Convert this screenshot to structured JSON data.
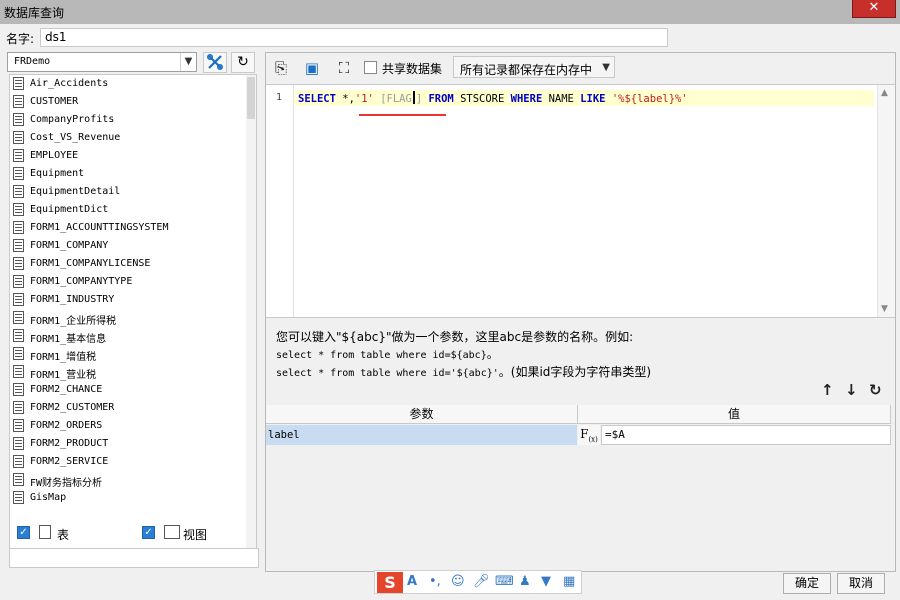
{
  "window": {
    "title": "数据库查询",
    "close_glyph": "✕"
  },
  "name_field": {
    "label": "名字:",
    "value": "ds1"
  },
  "left": {
    "connection": "FRDemo",
    "tables": [
      "Air_Accidents",
      "CUSTOMER",
      "CompanyProfits",
      "Cost_VS_Revenue",
      "EMPLOYEE",
      "Equipment",
      "EquipmentDetail",
      "EquipmentDict",
      "FORM1_ACCOUNTTINGSYSTEM",
      "FORM1_COMPANY",
      "FORM1_COMPANYLICENSE",
      "FORM1_COMPANYTYPE",
      "FORM1_INDUSTRY",
      "FORM1_企业所得税",
      "FORM1_基本信息",
      "FORM1_增值税",
      "FORM1_营业税",
      "FORM2_CHANCE",
      "FORM2_CUSTOMER",
      "FORM2_ORDERS",
      "FORM2_PRODUCT",
      "FORM2_SERVICE",
      "FW财务指标分析",
      "GisMap"
    ],
    "filters": {
      "table_label": "表",
      "view_label": "视图"
    }
  },
  "toolbar": {
    "share_label": "共享数据集",
    "storage_option": "所有记录都保存在内存中"
  },
  "editor": {
    "line_number": "1",
    "sql": {
      "kw_select": "SELECT",
      "part1": " *,",
      "literal1": "'1'",
      "flag": " [FLAG",
      "flag_close": "]",
      "kw_from": " FROM",
      "table": " STSCORE ",
      "kw_where": "WHERE",
      "column": " NAME ",
      "kw_like": "LIKE",
      "literal2": " '%${label}%'"
    }
  },
  "hint": {
    "line1": "您可以键入\"${abc}\"做为一个参数，这里abc是参数的名称。例如:",
    "line2_a": "select * from table where id=${abc}",
    "line2_b": "。",
    "line3_a": "select * from table where id='${abc}'",
    "line3_b": "。(如果id字段为字符串类型)"
  },
  "params": {
    "header_param": "参数",
    "header_value": "值",
    "rows": [
      {
        "name": "label",
        "value": "=$A"
      }
    ]
  },
  "buttons": {
    "ok": "确定",
    "cancel": "取消"
  },
  "ime": {
    "logo": "S"
  }
}
